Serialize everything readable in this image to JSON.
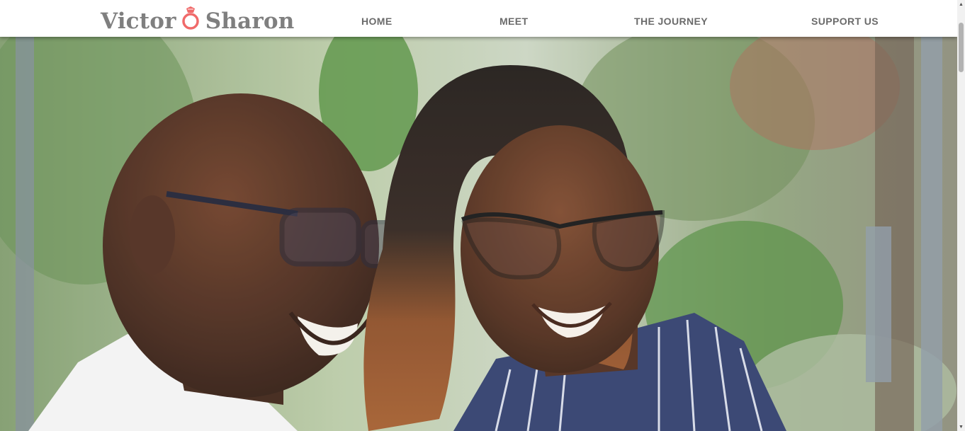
{
  "header": {
    "brand": {
      "first_name": "Victor",
      "second_name": "Sharon",
      "icon": "engagement-ring-icon",
      "icon_color": "#f06a6a",
      "text_color": "#7f7f7f"
    },
    "nav": [
      {
        "label": "HOME"
      },
      {
        "label": "MEET"
      },
      {
        "label": "THE JOURNEY"
      },
      {
        "label": "SUPPORT US"
      }
    ]
  },
  "hero": {
    "image": "couple-photo"
  },
  "scrollbar": {
    "up_icon": "scroll-up-arrow-icon",
    "down_icon": "scroll-down-arrow-icon"
  }
}
